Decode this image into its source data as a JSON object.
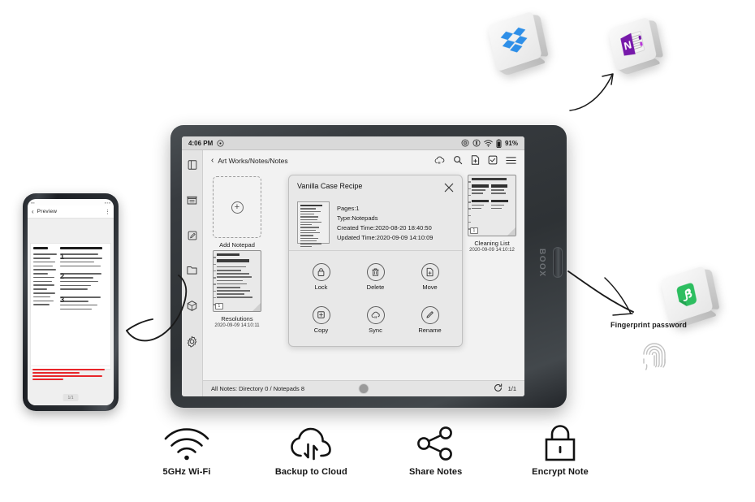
{
  "phone": {
    "header_title": "Preview",
    "back_icon": "chevron-left-icon",
    "menu_icon": "more-vertical-icon",
    "page_indicator": "1/1"
  },
  "tablet": {
    "brand": "BOOX",
    "status": {
      "time": "4:06 PM",
      "rotation_icon": "rotation-lock-icon",
      "refresh_icon": "refresh-mode-icon",
      "bluetooth_icon": "bluetooth-icon",
      "wifi_icon": "wifi-icon",
      "battery_icon": "battery-icon",
      "battery_text": "91%"
    },
    "sidebar": [
      {
        "name": "library-icon",
        "label": "Library"
      },
      {
        "name": "store-icon",
        "label": "Store"
      },
      {
        "name": "notes-icon",
        "label": "Notes"
      },
      {
        "name": "storage-icon",
        "label": "Storage"
      },
      {
        "name": "apps-icon",
        "label": "Apps"
      },
      {
        "name": "settings-icon",
        "label": "Settings"
      }
    ],
    "breadcrumb": {
      "back_icon": "chevron-left-icon",
      "path": "Art Works/Notes/Notes",
      "tools": [
        "cloud-sync-icon",
        "search-icon",
        "new-note-icon",
        "select-icon",
        "list-view-icon"
      ]
    },
    "notes": [
      {
        "label": "Add Notepad",
        "date": "",
        "type": "add"
      },
      {
        "label": "Resolutions",
        "date": "2020-09-09 14:10:11",
        "title": "2020 RESOLUTIONS",
        "type": "note"
      },
      {
        "label": "Cleaning List",
        "date": "2020-09-09 14:10:12",
        "title": "CLEANING LIST",
        "type": "note"
      }
    ],
    "dialog": {
      "title": "Vanilla Case Recipe",
      "close_icon": "close-icon",
      "meta": [
        "Pages:1",
        "Type:Notepads",
        "Created Time:2020-08-20 18:40:50",
        "Updated Time:2020-09-09 14:10:09"
      ],
      "actions": [
        {
          "label": "Lock",
          "icon": "lock-icon"
        },
        {
          "label": "Delete",
          "icon": "trash-icon"
        },
        {
          "label": "Move",
          "icon": "move-file-icon"
        },
        {
          "label": "Copy",
          "icon": "copy-icon"
        },
        {
          "label": "Sync",
          "icon": "cloud-sync-icon"
        },
        {
          "label": "Rename",
          "icon": "pencil-icon"
        }
      ]
    },
    "footer": {
      "status": "All Notes: Directory 0 / Notepads 8",
      "home_button": "home-button",
      "refresh_icon": "refresh-icon",
      "page_indicator": "1/1"
    }
  },
  "cloud_apps": [
    {
      "name": "dropbox-icon",
      "label": "Dropbox",
      "color": "#1f8ded"
    },
    {
      "name": "onenote-icon",
      "label": "OneNote",
      "color": "#7719aa"
    },
    {
      "name": "evernote-icon",
      "label": "Evernote",
      "color": "#2dbe60"
    }
  ],
  "fingerprint": {
    "label": "Fingerprint password",
    "icon": "fingerprint-icon"
  },
  "features": [
    {
      "label": "5GHz Wi-Fi",
      "icon": "wifi-icon"
    },
    {
      "label": "Backup to Cloud",
      "icon": "cloud-upload-icon"
    },
    {
      "label": "Share Notes",
      "icon": "share-icon"
    },
    {
      "label": "Encrypt Note",
      "icon": "lock-icon"
    }
  ]
}
